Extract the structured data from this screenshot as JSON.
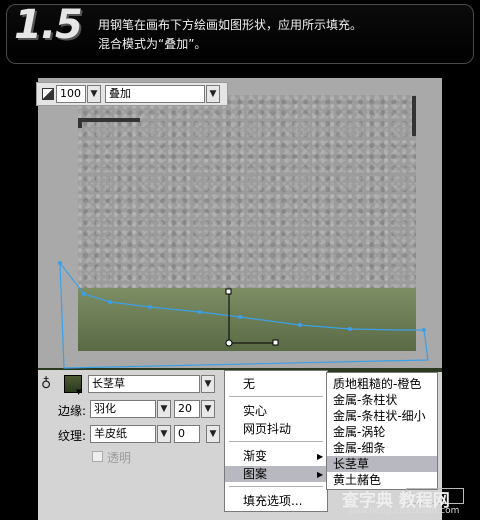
{
  "header": {
    "step": "1.5",
    "line1": "用钢笔在画布下方绘画如图形状，应用所示填充。",
    "line2": "混合模式为“叠加”。"
  },
  "blend": {
    "opacity": "100",
    "mode": "叠加"
  },
  "fill": {
    "texture_name": "长茎草",
    "edge_label": "边缘:",
    "edge_value": "羽化",
    "edge_amount": "20",
    "texture_label": "纹理:",
    "texture_value": "羊皮纸",
    "texture_amount": "0",
    "transparent_label": "透明"
  },
  "fill_menu": {
    "items": [
      "无",
      "实心",
      "网页抖动",
      "渐变",
      "图案",
      "填充选项..."
    ]
  },
  "pattern_menu": {
    "items": [
      "质地粗糙的-橙色",
      "金属-条柱状",
      "金属-条柱状-细小",
      "金属-涡轮",
      "金属-细条",
      "长茎草",
      "黄土赭色"
    ],
    "selected": "长茎草"
  },
  "watermark": {
    "top": "查字典 教程网",
    "bottom": "jiaocheng.chazidian.com"
  }
}
